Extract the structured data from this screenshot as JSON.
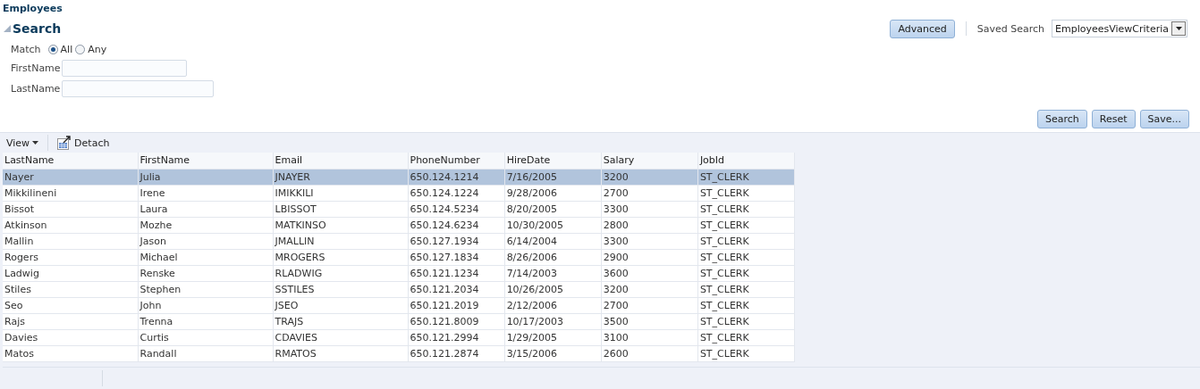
{
  "panel": {
    "title": "Employees"
  },
  "search": {
    "title": "Search",
    "expanded": true,
    "advanced_button": "Advanced",
    "saved_search_label": "Saved Search",
    "saved_search_value": "EmployeesViewCriteria",
    "match_label": "Match",
    "match_options": [
      {
        "label": "All",
        "selected": true
      },
      {
        "label": "Any",
        "selected": false
      }
    ],
    "fields": [
      {
        "label": "FirstName"
      },
      {
        "label": "LastName"
      }
    ],
    "buttons": [
      "Search",
      "Reset",
      "Save..."
    ]
  },
  "toolbar": {
    "view_menu": "View",
    "detach_button": "Detach"
  },
  "table": {
    "columns": [
      "LastName",
      "FirstName",
      "Email",
      "PhoneNumber",
      "HireDate",
      "Salary",
      "JobId"
    ],
    "rows": [
      {
        "selected": true,
        "cells": [
          "Nayer",
          "Julia",
          "JNAYER",
          "650.124.1214",
          "7/16/2005",
          "3200",
          "ST_CLERK"
        ]
      },
      {
        "selected": false,
        "cells": [
          "Mikkilineni",
          "Irene",
          "IMIKKILI",
          "650.124.1224",
          "9/28/2006",
          "2700",
          "ST_CLERK"
        ]
      },
      {
        "selected": false,
        "cells": [
          "Bissot",
          "Laura",
          "LBISSOT",
          "650.124.5234",
          "8/20/2005",
          "3300",
          "ST_CLERK"
        ]
      },
      {
        "selected": false,
        "cells": [
          "Atkinson",
          "Mozhe",
          "MATKINSO",
          "650.124.6234",
          "10/30/2005",
          "2800",
          "ST_CLERK"
        ]
      },
      {
        "selected": false,
        "cells": [
          "Mallin",
          "Jason",
          "JMALLIN",
          "650.127.1934",
          "6/14/2004",
          "3300",
          "ST_CLERK"
        ]
      },
      {
        "selected": false,
        "cells": [
          "Rogers",
          "Michael",
          "MROGERS",
          "650.127.1834",
          "8/26/2006",
          "2900",
          "ST_CLERK"
        ]
      },
      {
        "selected": false,
        "cells": [
          "Ladwig",
          "Renske",
          "RLADWIG",
          "650.121.1234",
          "7/14/2003",
          "3600",
          "ST_CLERK"
        ]
      },
      {
        "selected": false,
        "cells": [
          "Stiles",
          "Stephen",
          "SSTILES",
          "650.121.2034",
          "10/26/2005",
          "3200",
          "ST_CLERK"
        ]
      },
      {
        "selected": false,
        "cells": [
          "Seo",
          "John",
          "JSEO",
          "650.121.2019",
          "2/12/2006",
          "2700",
          "ST_CLERK"
        ]
      },
      {
        "selected": false,
        "cells": [
          "Rajs",
          "Trenna",
          "TRAJS",
          "650.121.8009",
          "10/17/2003",
          "3500",
          "ST_CLERK"
        ]
      },
      {
        "selected": false,
        "cells": [
          "Davies",
          "Curtis",
          "CDAVIES",
          "650.121.2994",
          "1/29/2005",
          "3100",
          "ST_CLERK"
        ]
      },
      {
        "selected": false,
        "cells": [
          "Matos",
          "Randall",
          "RMATOS",
          "650.121.2874",
          "3/15/2006",
          "2600",
          "ST_CLERK"
        ]
      }
    ]
  }
}
